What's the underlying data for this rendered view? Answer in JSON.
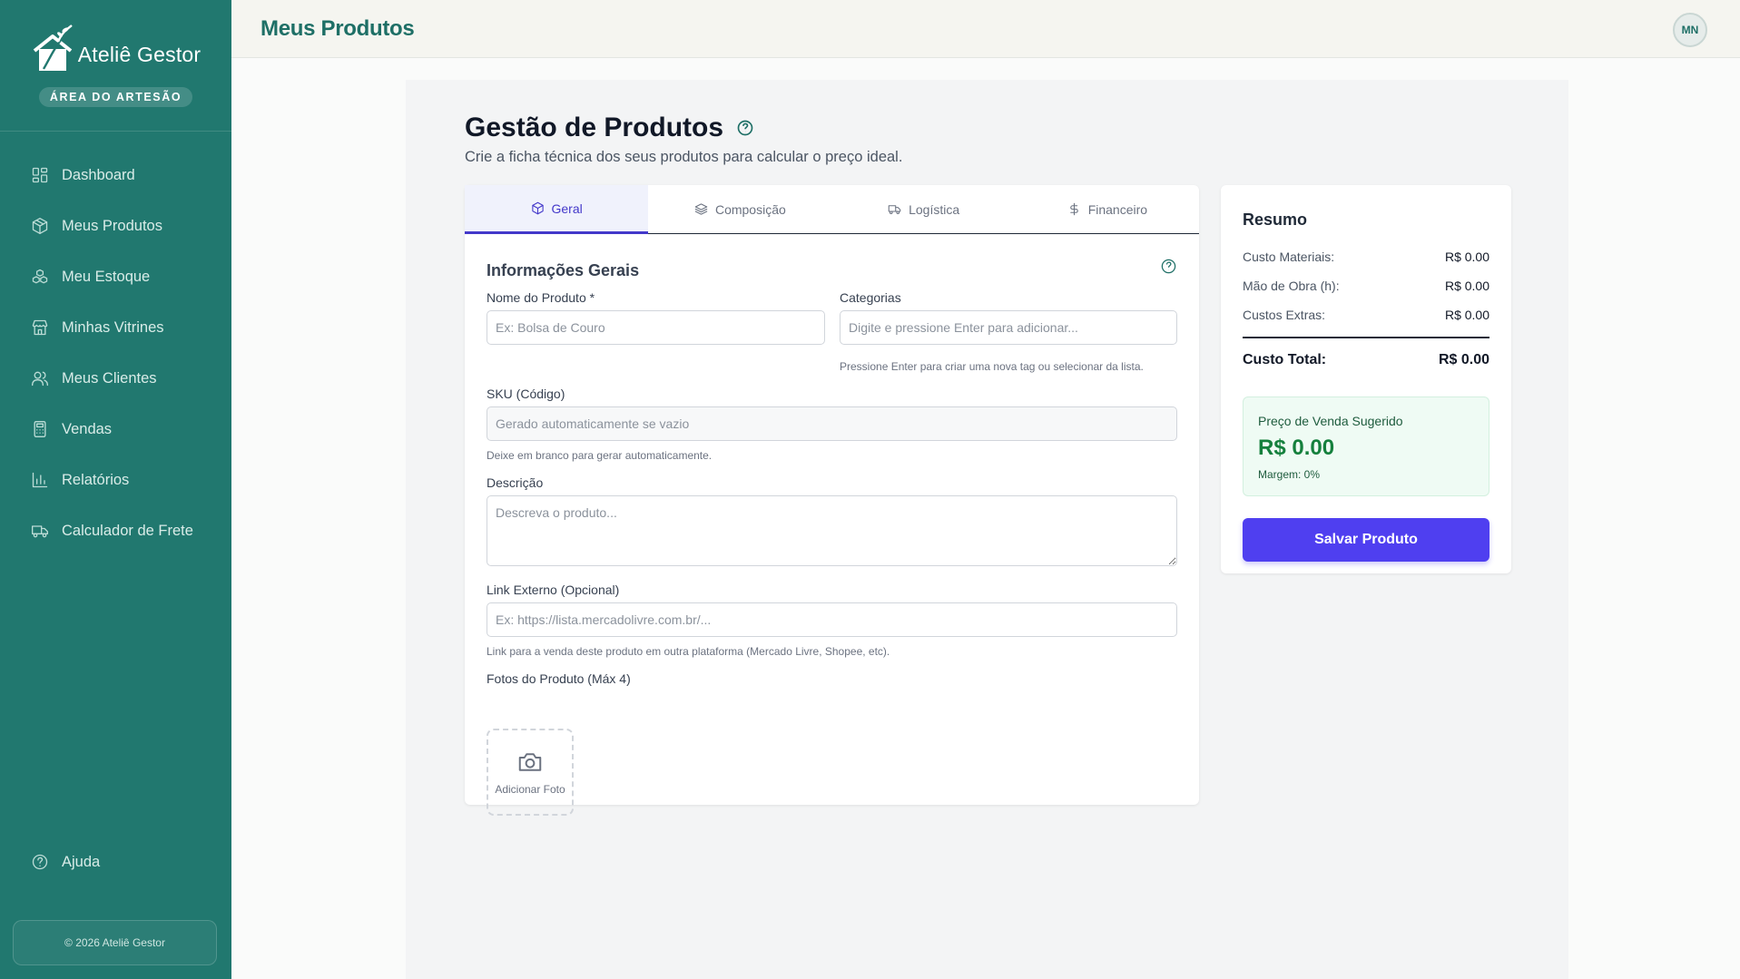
{
  "app": {
    "brand_name": "Ateliê Gestor",
    "brand_badge": "ÁREA DO ARTESÃO",
    "footer": "© 2026 Ateliê Gestor"
  },
  "sidebar": {
    "items": [
      {
        "label": "Dashboard",
        "icon": "dashboard-icon"
      },
      {
        "label": "Meus Produtos",
        "icon": "box-icon"
      },
      {
        "label": "Meu Estoque",
        "icon": "boxes-icon"
      },
      {
        "label": "Minhas Vitrines",
        "icon": "store-icon"
      },
      {
        "label": "Meus Clientes",
        "icon": "users-icon"
      },
      {
        "label": "Vendas",
        "icon": "calculator-icon"
      },
      {
        "label": "Relatórios",
        "icon": "bar-chart-icon"
      },
      {
        "label": "Calculador de Frete",
        "icon": "truck-icon"
      }
    ],
    "help": "Ajuda"
  },
  "topbar": {
    "title": "Meus Produtos",
    "avatar": "MN"
  },
  "page": {
    "title": "Gestão de Produtos",
    "subtitle": "Crie a ficha técnica dos seus produtos para calcular o preço ideal."
  },
  "tabs": [
    {
      "label": "Geral",
      "icon": "box-icon",
      "active": true
    },
    {
      "label": "Composição",
      "icon": "layers-icon",
      "active": false
    },
    {
      "label": "Logística",
      "icon": "truck-icon",
      "active": false
    },
    {
      "label": "Financeiro",
      "icon": "dollar-icon",
      "active": false
    }
  ],
  "form": {
    "section_title": "Informações Gerais",
    "name_label": "Nome do Produto *",
    "name_placeholder": "Ex: Bolsa de Couro",
    "categories_label": "Categorias",
    "categories_placeholder": "Digite e pressione Enter para adicionar...",
    "categories_hint": "Pressione Enter para criar uma nova tag ou selecionar da lista.",
    "sku_label": "SKU (Código)",
    "sku_placeholder": "Gerado automaticamente se vazio",
    "sku_hint": "Deixe em branco para gerar automaticamente.",
    "description_label": "Descrição",
    "description_placeholder": "Descreva o produto...",
    "link_label": "Link Externo (Opcional)",
    "link_placeholder": "Ex: https://lista.mercadolivre.com.br/...",
    "link_hint": "Link para a venda deste produto em outra plataforma (Mercado Livre, Shopee, etc).",
    "photos_label": "Fotos do Produto (Máx 4)",
    "add_photo": "Adicionar Foto"
  },
  "summary": {
    "title": "Resumo",
    "rows": [
      {
        "label": "Custo Materiais:",
        "value": "R$ 0.00"
      },
      {
        "label": "Mão de Obra (h):",
        "value": "R$ 0.00"
      },
      {
        "label": "Custos Extras:",
        "value": "R$ 0.00"
      }
    ],
    "total_label": "Custo Total:",
    "total_value": "R$ 0.00",
    "price_label": "Preço de Venda Sugerido",
    "price_value": "R$ 0.00",
    "margin": "Margem: 0%",
    "save_button": "Salvar Produto"
  },
  "colors": {
    "sidebar": "#21786f",
    "accent": "#4f3ff0",
    "positive": "#15803d"
  }
}
